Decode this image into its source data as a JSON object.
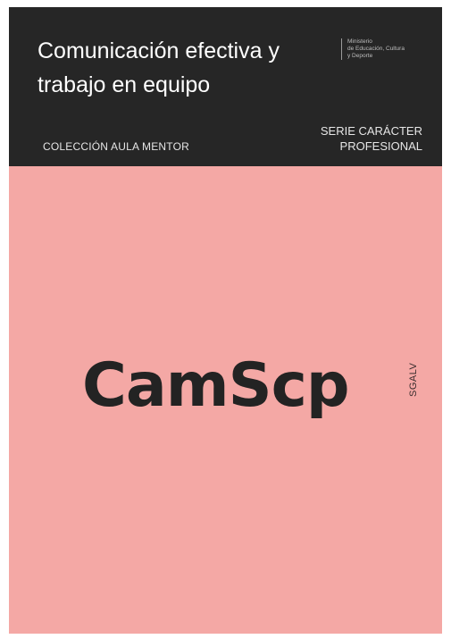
{
  "cover": {
    "title": "Comunicación efectiva y trabajo en equipo",
    "collection": "COLECCIÓN AULA MENTOR",
    "ministry": "Ministerio\nde Educación, Cultura\ny Deporte",
    "series": "SERIE CARÁCTER\nPROFESIONAL",
    "watermark": "CamScp",
    "vertical_code": "SGALV"
  },
  "colors": {
    "header_background": "#262626",
    "cover_background": "#f4a8a5",
    "watermark_text": "#232323"
  }
}
